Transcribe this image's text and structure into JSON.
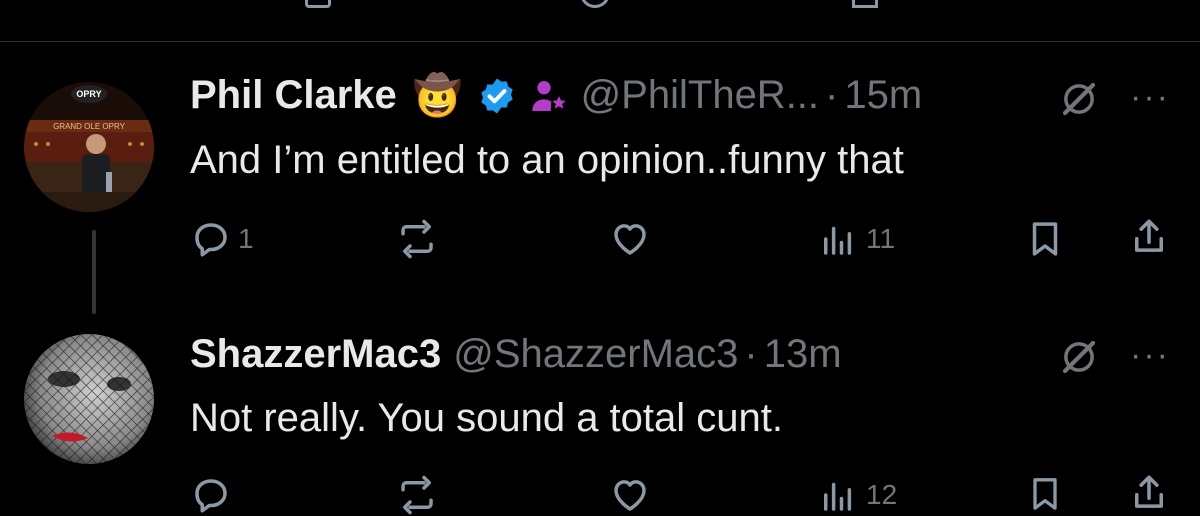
{
  "tweets": [
    {
      "name": "Phil Clarke",
      "handle": "@PhilTheR...",
      "dot": "·",
      "time": "15m",
      "text": "And I’m entitled to an opinion..funny that",
      "emoji": "🤠",
      "avatar_sign": "GRAND OLE OPRY",
      "replies": "1",
      "retweets": "",
      "likes": "",
      "views": "11",
      "verified_color": "#1d9bf0",
      "subscriber_icon_color": "#b33dc6"
    },
    {
      "name": "ShazzerMac3",
      "handle": "@ShazzerMac3",
      "dot": "·",
      "time": "13m",
      "text": "Not really.  You sound a total cunt.",
      "replies": "",
      "retweets": "",
      "likes": "",
      "views": "12"
    }
  ],
  "more_label": "···"
}
